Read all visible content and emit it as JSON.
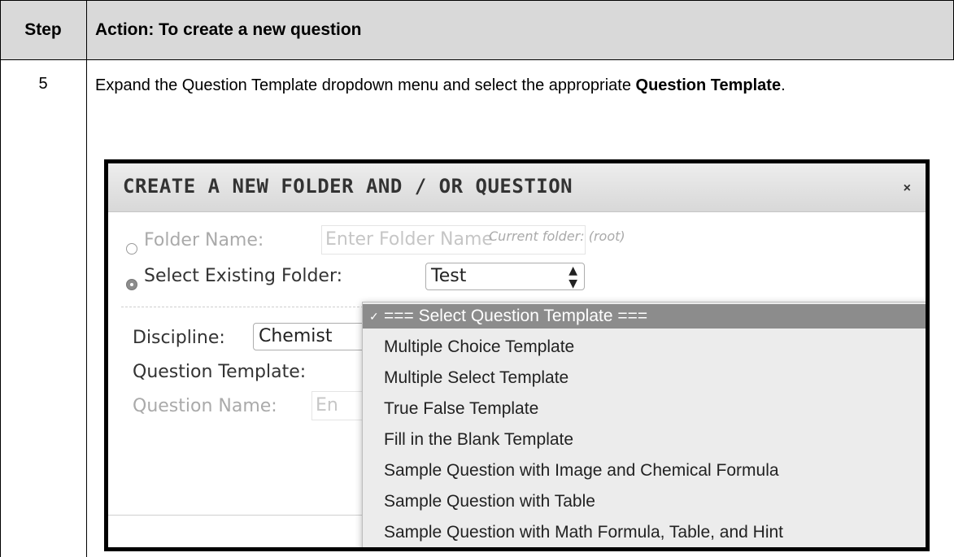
{
  "table": {
    "header": {
      "step": "Step",
      "action": "Action: To create a new question"
    },
    "row": {
      "step": "5",
      "instruction_pre": "Expand the Question Template dropdown menu and select the appropriate ",
      "instruction_bold": "Question Template",
      "instruction_post": "."
    }
  },
  "dialog": {
    "title": "CREATE A NEW FOLDER AND / OR QUESTION",
    "close": "×",
    "folder_name_label": "Folder Name:",
    "folder_name_placeholder": "Enter Folder Name",
    "current_folder_hint": "Current folder: (root)",
    "existing_folder_label": "Select Existing Folder:",
    "existing_folder_value": "Test",
    "discipline_label": "Discipline:",
    "discipline_value": "Chemist",
    "question_template_label": "Question Template:",
    "question_name_label": "Question Name:",
    "question_name_placeholder": "En"
  },
  "dropdown": {
    "check": "✓",
    "options": [
      "=== Select Question Template ===",
      "Multiple Choice Template",
      "Multiple Select Template",
      "True False Template",
      "Fill in the Blank Template",
      "Sample Question with Image and Chemical Formula",
      "Sample Question with Table",
      "Sample Question with Math Formula, Table, and Hint"
    ],
    "selected_index": 0
  }
}
